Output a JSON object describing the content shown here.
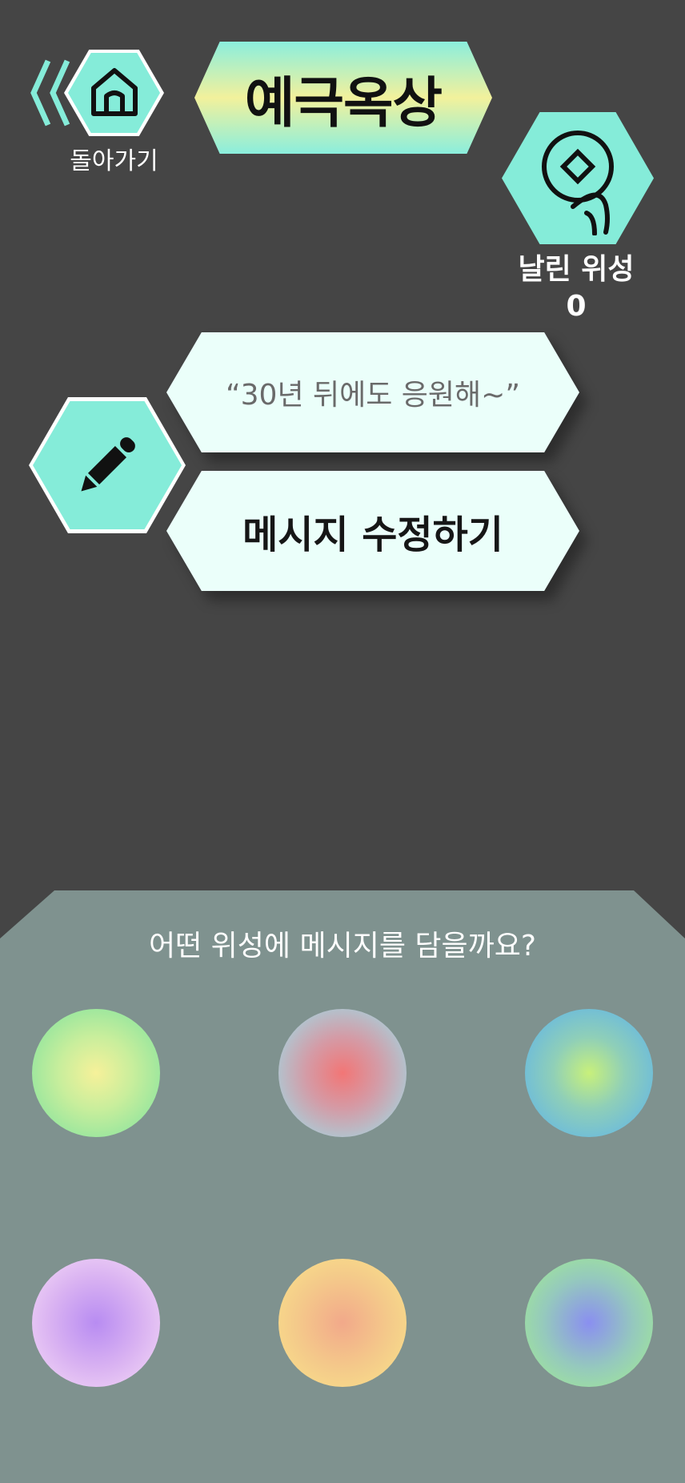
{
  "header": {
    "back_label": "돌아가기",
    "title": "예극옥상",
    "home_icon": "home-icon",
    "back_icon": "double-chevron-left-icon"
  },
  "satellites": {
    "label": "날린 위성",
    "count": "0",
    "icon": "satellite-icon"
  },
  "message": {
    "quote": "“30년 뒤에도 응원해~”",
    "edit_label": "메시지 수정하기",
    "edit_icon": "pencil-icon"
  },
  "chooser": {
    "prompt": "어떤 위성에 메시지를 담을까요?",
    "orbs": [
      {
        "name": "yellow-green"
      },
      {
        "name": "red-cyan"
      },
      {
        "name": "lime-blue"
      },
      {
        "name": "purple-pink"
      },
      {
        "name": "orange-yellow"
      },
      {
        "name": "blue-green"
      }
    ]
  },
  "colors": {
    "background": "#454545",
    "accent": "#85ecd9",
    "panel": "#7f928f",
    "card": "#ebfffa"
  }
}
